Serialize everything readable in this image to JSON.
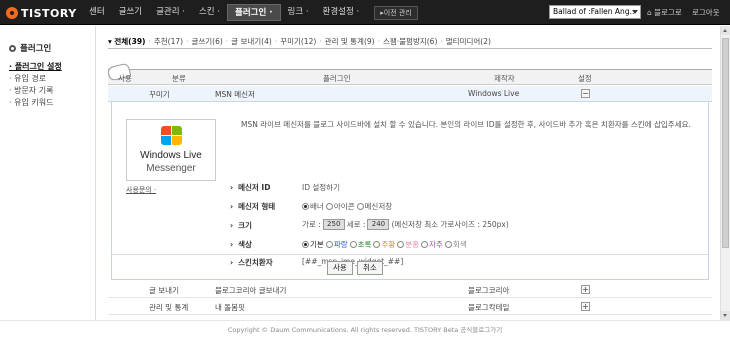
{
  "topbar": {
    "logo": "TISTORY",
    "nav": [
      {
        "label": "센터"
      },
      {
        "label": "글쓰기"
      },
      {
        "label": "글관리 ·"
      },
      {
        "label": "스킨 ·"
      },
      {
        "label": "플러그인 ·"
      },
      {
        "label": "링크 ·"
      },
      {
        "label": "환경설정 ·"
      }
    ],
    "prev_button": "▸이전 관리",
    "blog_select": "Ballad of :Fallen Ang..",
    "home_link": "⌂ 블로그로",
    "logout_link": "로그아웃"
  },
  "sidebar": {
    "title": "플러그인",
    "items": [
      {
        "label": "· 플러그인 설정"
      },
      {
        "label": "· 유입 경로"
      },
      {
        "label": "· 방문자 기록"
      },
      {
        "label": "· 유입 키워드"
      }
    ]
  },
  "filters": [
    {
      "label": "▾ 전체(39)"
    },
    {
      "label": "추천(17)"
    },
    {
      "label": "글쓰기(6)"
    },
    {
      "label": "글 보내기(4)"
    },
    {
      "label": "꾸미기(12)"
    },
    {
      "label": "관리 및 통계(9)"
    },
    {
      "label": "스팸·불펌방지(6)"
    },
    {
      "label": "멀티미디어(2)"
    }
  ],
  "table": {
    "headers": {
      "use": "사용",
      "category": "분류",
      "plugin": "플러그인",
      "author": "제작자",
      "settings": "설정"
    },
    "open_row": {
      "category": "꾸미기",
      "plugin": "MSN 메신저",
      "author": "Windows Live",
      "toggle": "−"
    },
    "rows": [
      {
        "category": "글 보내기",
        "plugin": "블로그코리아 글보내기",
        "author": "블로그코리아",
        "toggle": "+"
      },
      {
        "category": "관리 및 통계",
        "plugin": "내 돌봄핏",
        "author": "블로그칵테일",
        "toggle": "+"
      }
    ]
  },
  "detail": {
    "logo_line1": "Windows Live",
    "logo_line2": "Messenger",
    "help_link": "사용문의 ·",
    "description": "MSN 라이브 메신저를 블로그 사이드바에 설치 할 수 있습니다. 본인의 라이브 ID를 설정한 후, 사이드바 추가 혹은 치환자를 스킨에 삽입주세요.",
    "fields": {
      "id_label": "메신저 ID",
      "id_value": "ID 설정하기",
      "type_label": "메신저 형태",
      "type_options": [
        "배너",
        "아이콘",
        "메신저창"
      ],
      "size_label": "크기",
      "size_width_label": "가로 :",
      "size_width": "250",
      "size_height_label": "세로 :",
      "size_height": "240",
      "size_note": "(메신저창 최소 가로사이즈 : 250px)",
      "color_label": "색상",
      "color_options": [
        {
          "label": "기본",
          "color": "#222222"
        },
        {
          "label": "파랑",
          "color": "#2255cc"
        },
        {
          "label": "초록",
          "color": "#2a8a2a"
        },
        {
          "label": "주황",
          "color": "#e09020"
        },
        {
          "label": "분홍",
          "color": "#ee88aa"
        },
        {
          "label": "자주",
          "color": "#bb44cc"
        },
        {
          "label": "회색",
          "color": "#888888"
        }
      ],
      "substitute_label": "스킨치환자",
      "substitute_value": "[##_msn_ime_widget_##]"
    },
    "buttons": {
      "use": "사용",
      "cancel": "취소"
    }
  },
  "footer": "Copyright © Daum Communications. All rights reserved. TISTORY Beta 공식블로그가기"
}
